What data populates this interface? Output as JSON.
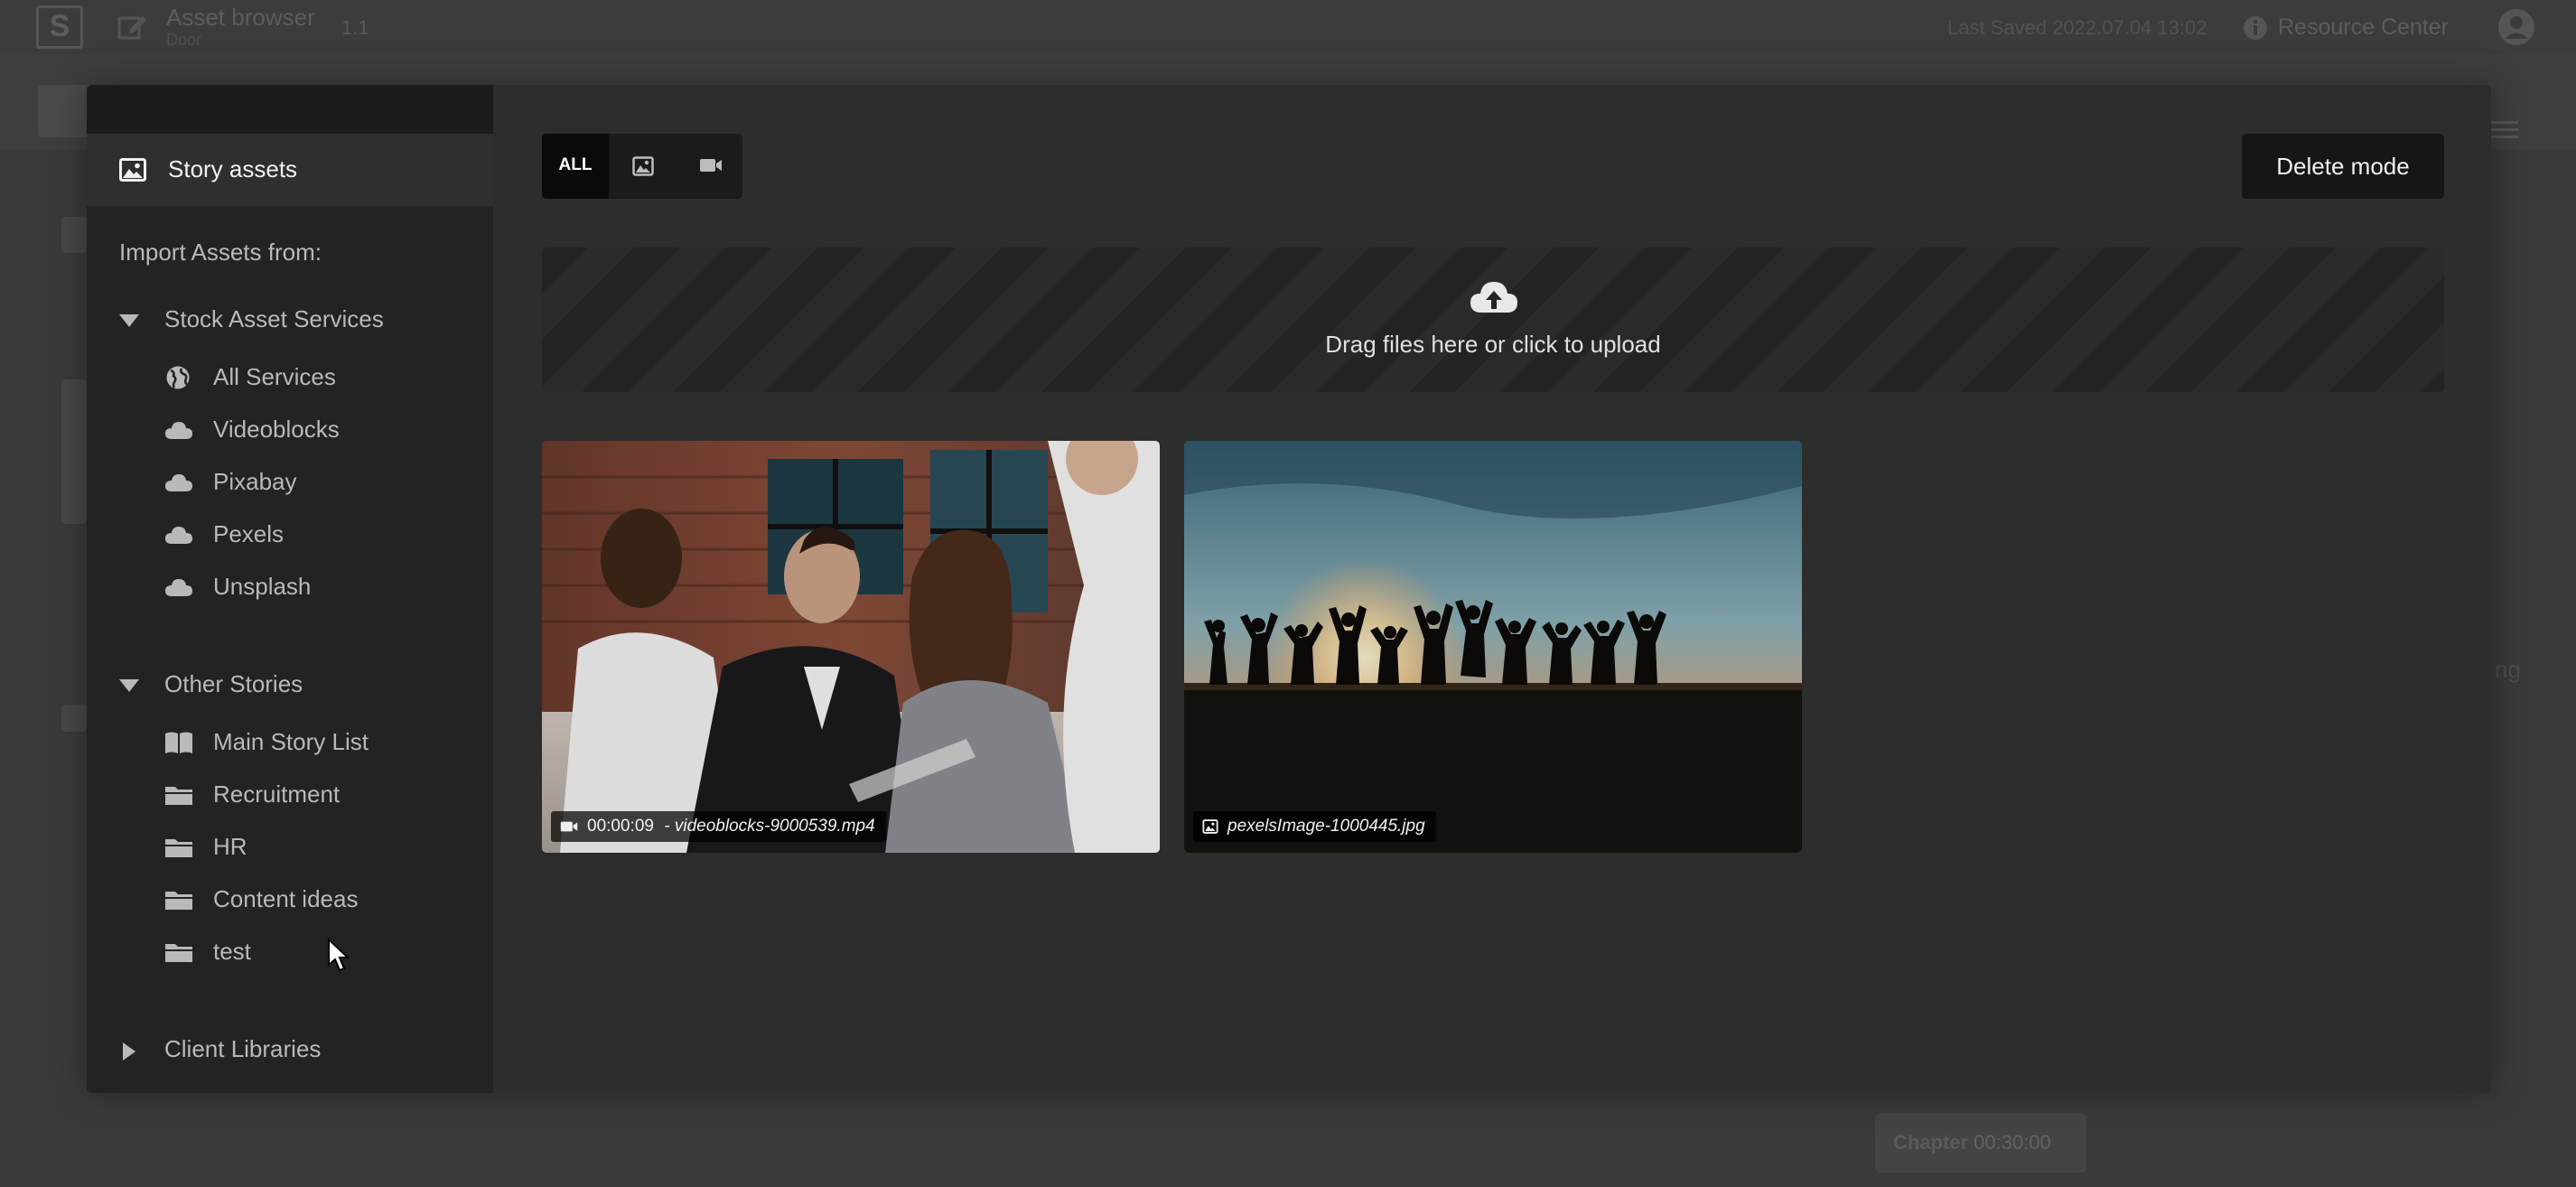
{
  "background_app": {
    "title": "Asset browser",
    "subtitle": "Door",
    "version": "1.1",
    "last_saved": "Last Saved 2022.07.04 13:02",
    "resource_center": "Resource Center",
    "footer_label": "Chapter",
    "footer_value": "00:30:00",
    "edge_text": "ng"
  },
  "sidebar": {
    "header_label": "Story assets",
    "import_label": "Import Assets from:",
    "sections": [
      {
        "label": "Stock Asset Services",
        "expanded": true,
        "items": [
          {
            "label": "All Services",
            "icon": "globe-icon"
          },
          {
            "label": "Videoblocks",
            "icon": "cloud-icon"
          },
          {
            "label": "Pixabay",
            "icon": "cloud-icon"
          },
          {
            "label": "Pexels",
            "icon": "cloud-icon"
          },
          {
            "label": "Unsplash",
            "icon": "cloud-icon"
          }
        ]
      },
      {
        "label": "Other Stories",
        "expanded": true,
        "items": [
          {
            "label": "Main Story List",
            "icon": "book-icon"
          },
          {
            "label": "Recruitment",
            "icon": "folder-icon"
          },
          {
            "label": "HR",
            "icon": "folder-icon"
          },
          {
            "label": "Content ideas",
            "icon": "folder-icon"
          },
          {
            "label": "test",
            "icon": "folder-icon"
          }
        ]
      },
      {
        "label": "Client Libraries",
        "expanded": false,
        "items": []
      }
    ]
  },
  "filters": {
    "all_label": "ALL",
    "active": "all",
    "buttons": [
      "all",
      "image-icon",
      "video-icon"
    ]
  },
  "toolbar": {
    "delete_label": "Delete mode"
  },
  "upload": {
    "label": "Drag files here or click to upload",
    "icon": "cloud-upload-icon"
  },
  "assets": [
    {
      "type": "video",
      "duration": "00:00:09",
      "separator": " - ",
      "filename": "videoblocks-9000539.mp4"
    },
    {
      "type": "image",
      "filename": "pexelsImage-1000445.jpg"
    }
  ],
  "colors": {
    "modal_bg": "#2d2d2d",
    "sidebar_bg": "#232323",
    "sidebar_header_bg": "#2f2f2f",
    "delete_button_bg": "#161616",
    "text_muted": "#b9b9b9"
  }
}
